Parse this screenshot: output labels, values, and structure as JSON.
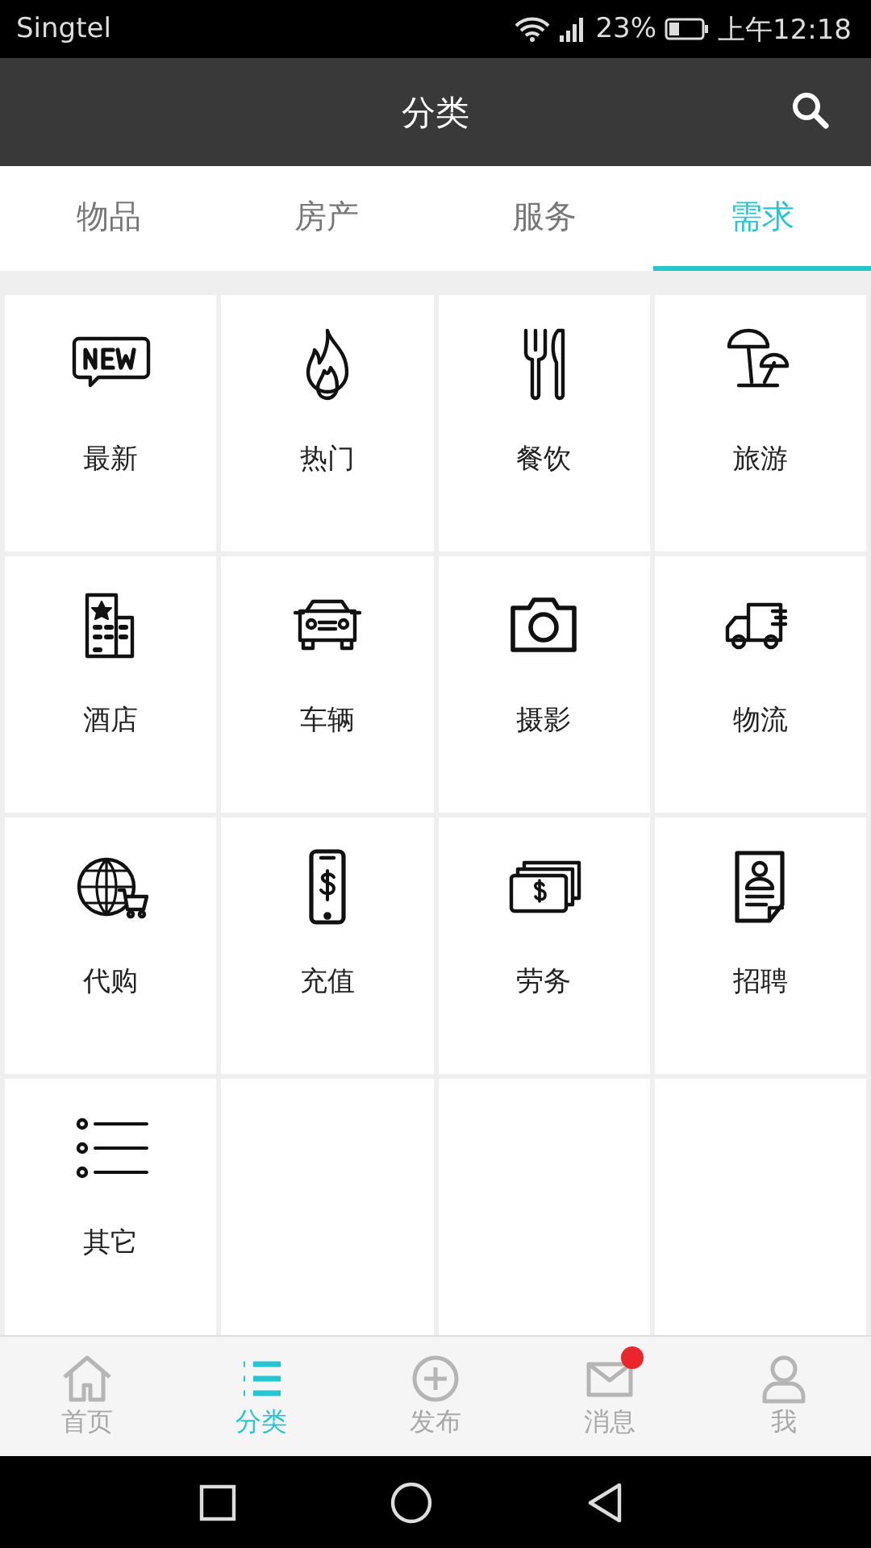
{
  "status_bar": {
    "carrier": "Singtel",
    "battery": "23%",
    "time": "上午12:18"
  },
  "header": {
    "title": "分类"
  },
  "tabs": [
    {
      "label": "物品",
      "selected": false
    },
    {
      "label": "房产",
      "selected": false
    },
    {
      "label": "服务",
      "selected": false
    },
    {
      "label": "需求",
      "selected": true
    }
  ],
  "categories": [
    {
      "label": "最新"
    },
    {
      "label": "热门"
    },
    {
      "label": "餐饮"
    },
    {
      "label": "旅游"
    },
    {
      "label": "酒店"
    },
    {
      "label": "车辆"
    },
    {
      "label": "摄影"
    },
    {
      "label": "物流"
    },
    {
      "label": "代购"
    },
    {
      "label": "充值"
    },
    {
      "label": "劳务"
    },
    {
      "label": "招聘"
    },
    {
      "label": "其它"
    }
  ],
  "bottom_nav": [
    {
      "label": "首页",
      "selected": false,
      "unread": false
    },
    {
      "label": "分类",
      "selected": true,
      "unread": false
    },
    {
      "label": "发布",
      "selected": false,
      "unread": false
    },
    {
      "label": "消息",
      "selected": false,
      "unread": true
    },
    {
      "label": "我",
      "selected": false,
      "unread": false
    }
  ]
}
